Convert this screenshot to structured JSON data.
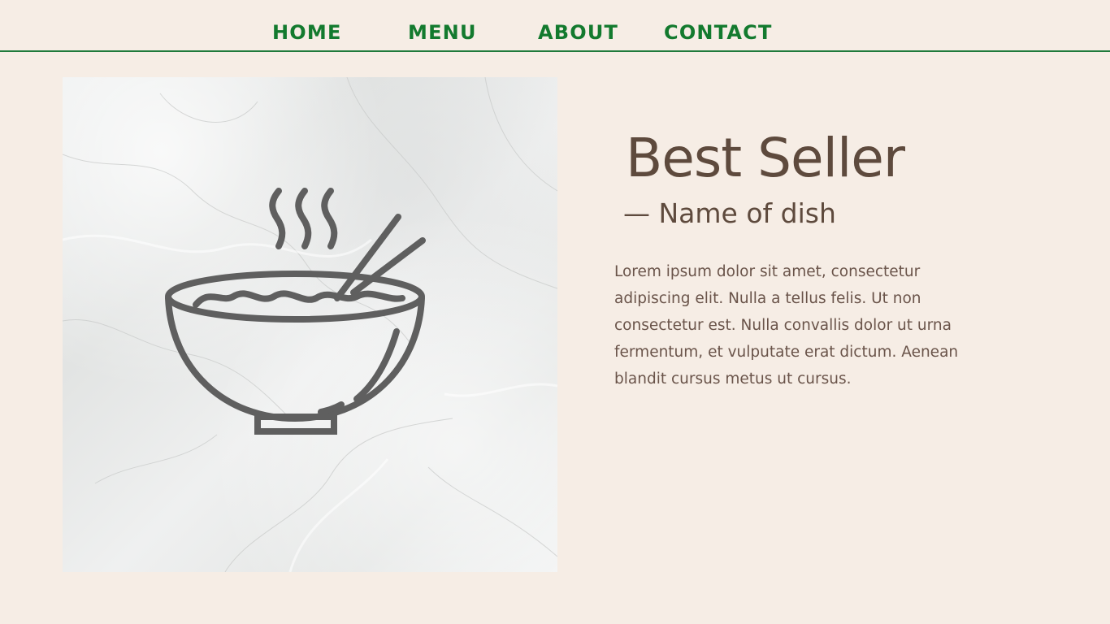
{
  "nav": {
    "items": [
      {
        "label": "HOME"
      },
      {
        "label": "MENU"
      },
      {
        "label": "ABOUT"
      },
      {
        "label": "CONTACT"
      }
    ]
  },
  "feature": {
    "title": "Best Seller",
    "subtitle": "— Name of dish",
    "description": "Lorem ipsum dolor sit amet, consectetur adipiscing elit. Nulla a tellus felis. Ut non consectetur est. Nulla convallis dolor ut urna fermentum, et vulputate erat dictum. Aenean blandit cursus metus ut cursus."
  },
  "image": {
    "icon": "noodle-bowl-icon",
    "background": "marble-texture"
  },
  "colors": {
    "page_background": "#f6ede5",
    "nav_text": "#137a2e",
    "nav_rule": "#1f7a3b",
    "heading_text": "#5e4a3d",
    "body_text": "#6a544a",
    "icon_stroke": "#5f5f5f"
  }
}
